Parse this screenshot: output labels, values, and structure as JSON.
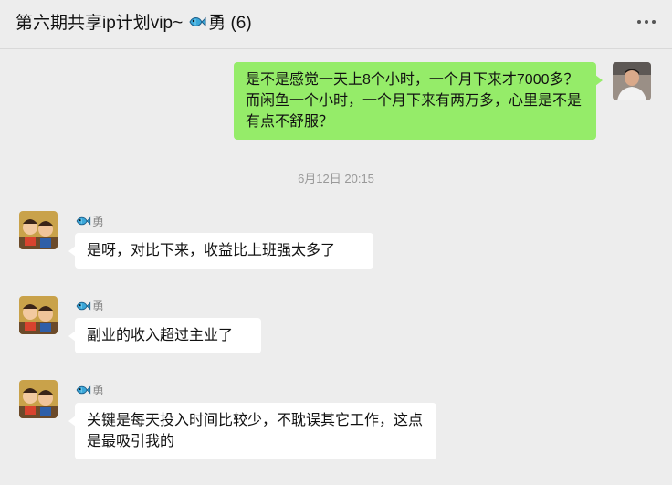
{
  "chat": {
    "title_prefix": "第六期共享ip计划vip~",
    "title_suffix": "勇 (6)"
  },
  "messages": [
    {
      "from": "me",
      "text": "是不是感觉一天上8个小时，一个月下来才7000多？而闲鱼一个小时，一个月下来有两万多，心里是不是有点不舒服？"
    },
    {
      "timestamp": "6月12日 20:15"
    },
    {
      "from": "other",
      "sender": "勇",
      "text": "是呀，对比下来，收益比上班强太多了"
    },
    {
      "from": "other",
      "sender": "勇",
      "text": "副业的收入超过主业了"
    },
    {
      "from": "other",
      "sender": "勇",
      "text": "关键是每天投入时间比较少，不耽误其它工作，这点是最吸引我的"
    }
  ],
  "icons": {
    "fish": "fish-icon",
    "more": "more-icon"
  },
  "colors": {
    "my_bubble": "#95ec69",
    "other_bubble": "#ffffff",
    "background": "#ededed"
  }
}
